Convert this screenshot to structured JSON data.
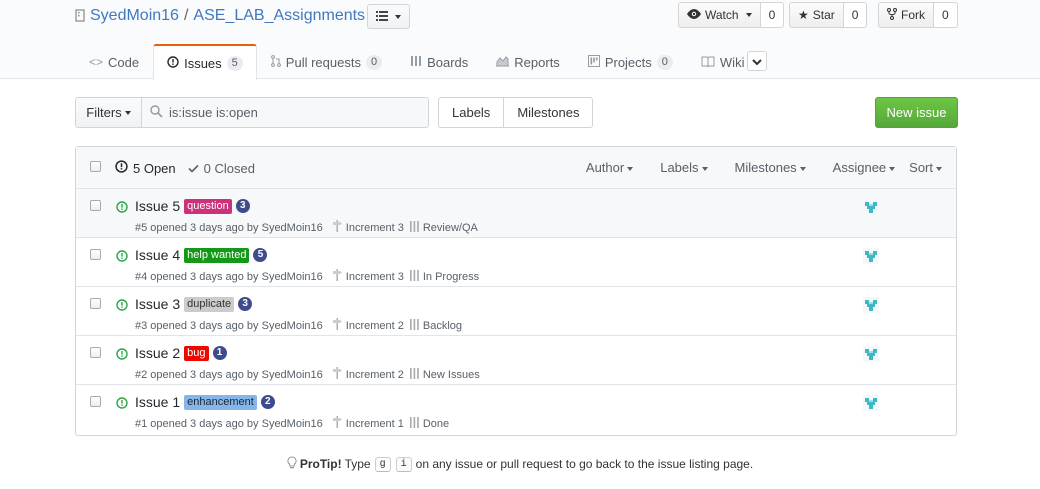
{
  "repo": {
    "owner": "SyedMoin16",
    "separator": "/",
    "name": "ASE_LAB_Assignments"
  },
  "social": {
    "watch_label": "Watch",
    "watch_count": "0",
    "star_label": "Star",
    "star_count": "0",
    "fork_label": "Fork",
    "fork_count": "0"
  },
  "tabs": [
    {
      "label": "Code",
      "icon": "code-icon",
      "counter": null
    },
    {
      "label": "Issues",
      "icon": "issue-opened-icon",
      "counter": "5"
    },
    {
      "label": "Pull requests",
      "icon": "git-pull-request-icon",
      "counter": "0"
    },
    {
      "label": "Boards",
      "icon": "boards-icon",
      "counter": null
    },
    {
      "label": "Reports",
      "icon": "graph-icon",
      "counter": null
    },
    {
      "label": "Projects",
      "icon": "project-icon",
      "counter": "0"
    },
    {
      "label": "Wiki",
      "icon": "book-icon",
      "counter": null
    }
  ],
  "filters": {
    "filters_label": "Filters",
    "search_value": "is:issue is:open",
    "labels_label": "Labels",
    "milestones_label": "Milestones",
    "new_issue_label": "New issue"
  },
  "list_header": {
    "open_label": "5 Open",
    "closed_label": "0 Closed",
    "author": "Author",
    "labels": "Labels",
    "milestones": "Milestones",
    "assignee": "Assignee",
    "sort": "Sort"
  },
  "issues": [
    {
      "title": "Issue 5",
      "label": "question",
      "label_bg": "#cc317c",
      "label_fg": "#ffffff",
      "estimate": "3",
      "meta": "#5 opened 3 days ago by SyedMoin16",
      "milestone": "Increment 3",
      "pipeline": "Review/QA"
    },
    {
      "title": "Issue 4",
      "label": "help wanted",
      "label_bg": "#159818",
      "label_fg": "#ffffff",
      "estimate": "5",
      "meta": "#4 opened 3 days ago by SyedMoin16",
      "milestone": "Increment 3",
      "pipeline": "In Progress"
    },
    {
      "title": "Issue 3",
      "label": "duplicate",
      "label_bg": "#cccccc",
      "label_fg": "#333333",
      "estimate": "3",
      "meta": "#3 opened 3 days ago by SyedMoin16",
      "milestone": "Increment 2",
      "pipeline": "Backlog"
    },
    {
      "title": "Issue 2",
      "label": "bug",
      "label_bg": "#ee0701",
      "label_fg": "#ffffff",
      "estimate": "1",
      "meta": "#2 opened 3 days ago by SyedMoin16",
      "milestone": "Increment 2",
      "pipeline": "New Issues"
    },
    {
      "title": "Issue 1",
      "label": "enhancement",
      "label_bg": "#84b6eb",
      "label_fg": "#1c2733",
      "estimate": "2",
      "meta": "#1 opened 3 days ago by SyedMoin16",
      "milestone": "Increment 1",
      "pipeline": "Done"
    }
  ],
  "protip": {
    "bold": "ProTip!",
    "pre": "Type",
    "key1": "g",
    "key2": "i",
    "post": "on any issue or pull request to go back to the issue listing page."
  },
  "colors": {
    "link": "#4078c0",
    "tab_accent": "#e36209",
    "open_green": "#28a745",
    "new_issue_green": "#6cc644"
  }
}
